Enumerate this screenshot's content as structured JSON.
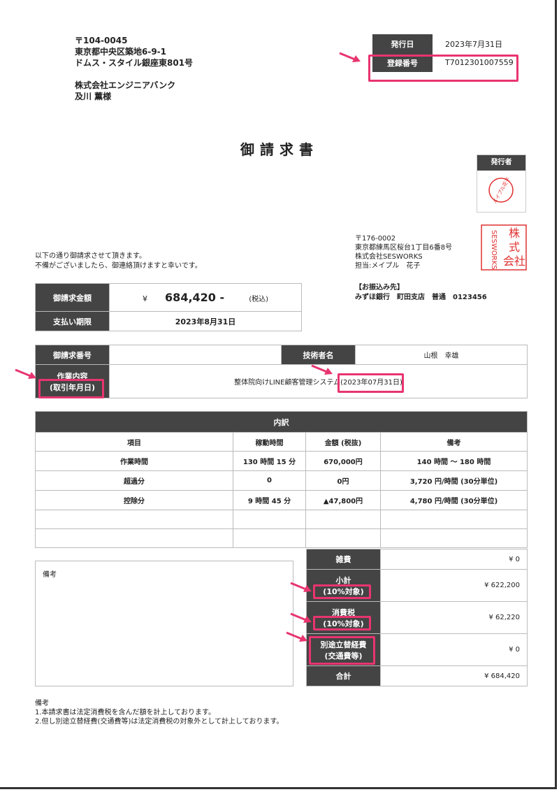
{
  "recipient": {
    "postal": "〒104-0045",
    "address1": "東京都中央区築地6-9-1",
    "address2": "ドムス・スタイル銀座東801号",
    "company": "株式会社エンジニアバンク",
    "person": "及川 薫様"
  },
  "header": {
    "issue_date_label": "発行日",
    "issue_date": "2023年7月31日",
    "reg_label": "登録番号",
    "reg_number": "T7012301007559"
  },
  "title": "御請求書",
  "issuer": {
    "label": "発行者",
    "seal_text": "メイプル花子",
    "postal": "〒176-0002",
    "address": "東京都練馬区桜台1丁目6番8号",
    "company": "株式会社SESWORKS",
    "contact": "担当:メイプル　花子",
    "company_seal_text": "株式会社SESWORKS"
  },
  "intro": {
    "line1": "以下の通り御請求させて頂きます。",
    "line2": "不備がございましたら、御連絡頂けますと幸いです。"
  },
  "bank": {
    "label": "【お振込み先】",
    "detail": "みずほ銀行　町田支店　普通　0123456"
  },
  "amount": {
    "label": "御請求金額",
    "currency": "¥",
    "value": "684,420 -",
    "tax_note": "(税込)",
    "due_label": "支払い期限",
    "due_date": "2023年8月31日"
  },
  "info": {
    "invoice_no_label": "御請求番号",
    "invoice_no": "",
    "engineer_label": "技術者名",
    "engineer": "山根　幸雄",
    "work_label1": "作業内容",
    "work_label2": "(取引年月日)",
    "work_desc": "整体院向けLINE顧客管理システム",
    "work_date": "(2023年07月31日)"
  },
  "details": {
    "title": "内訳",
    "headers": [
      "項目",
      "稼動時間",
      "金額 (税抜)",
      "備考"
    ],
    "rows": [
      [
        "作業時間",
        "130 時間 15 分",
        "670,000円",
        "140 時間 〜 180 時間"
      ],
      [
        "超過分",
        "0",
        "0円",
        "3,720 円/時間 (30分単位)"
      ],
      [
        "控除分",
        "9 時間 45 分",
        "▲47,800円",
        "4,780 円/時間 (30分単位)"
      ],
      [
        "",
        "",
        "",
        ""
      ],
      [
        "",
        "",
        "",
        ""
      ]
    ]
  },
  "memo_label": "備考",
  "summary": {
    "misc_label": "雑費",
    "misc": "¥ 0",
    "subtotal_label1": "小計",
    "subtotal_label2": "(10%対象)",
    "subtotal": "¥ 622,200",
    "tax_label1": "消費税",
    "tax_label2": "(10%対象)",
    "tax": "¥ 62,220",
    "transport_label1": "別途立替経費",
    "transport_label2": "(交通費等)",
    "transport": "¥ 0",
    "total_label": "合計",
    "total": "¥ 684,420"
  },
  "notes": {
    "title": "備考",
    "line1": "1.本請求書は法定消費税を含んだ額を計上しております。",
    "line2": "2.但し別途立替経費(交通費等)は法定消費税の対象外として計上しております。"
  },
  "colors": {
    "accent": "#e8346f",
    "dark_cell": "#444444",
    "seal_red": "#e03030"
  }
}
